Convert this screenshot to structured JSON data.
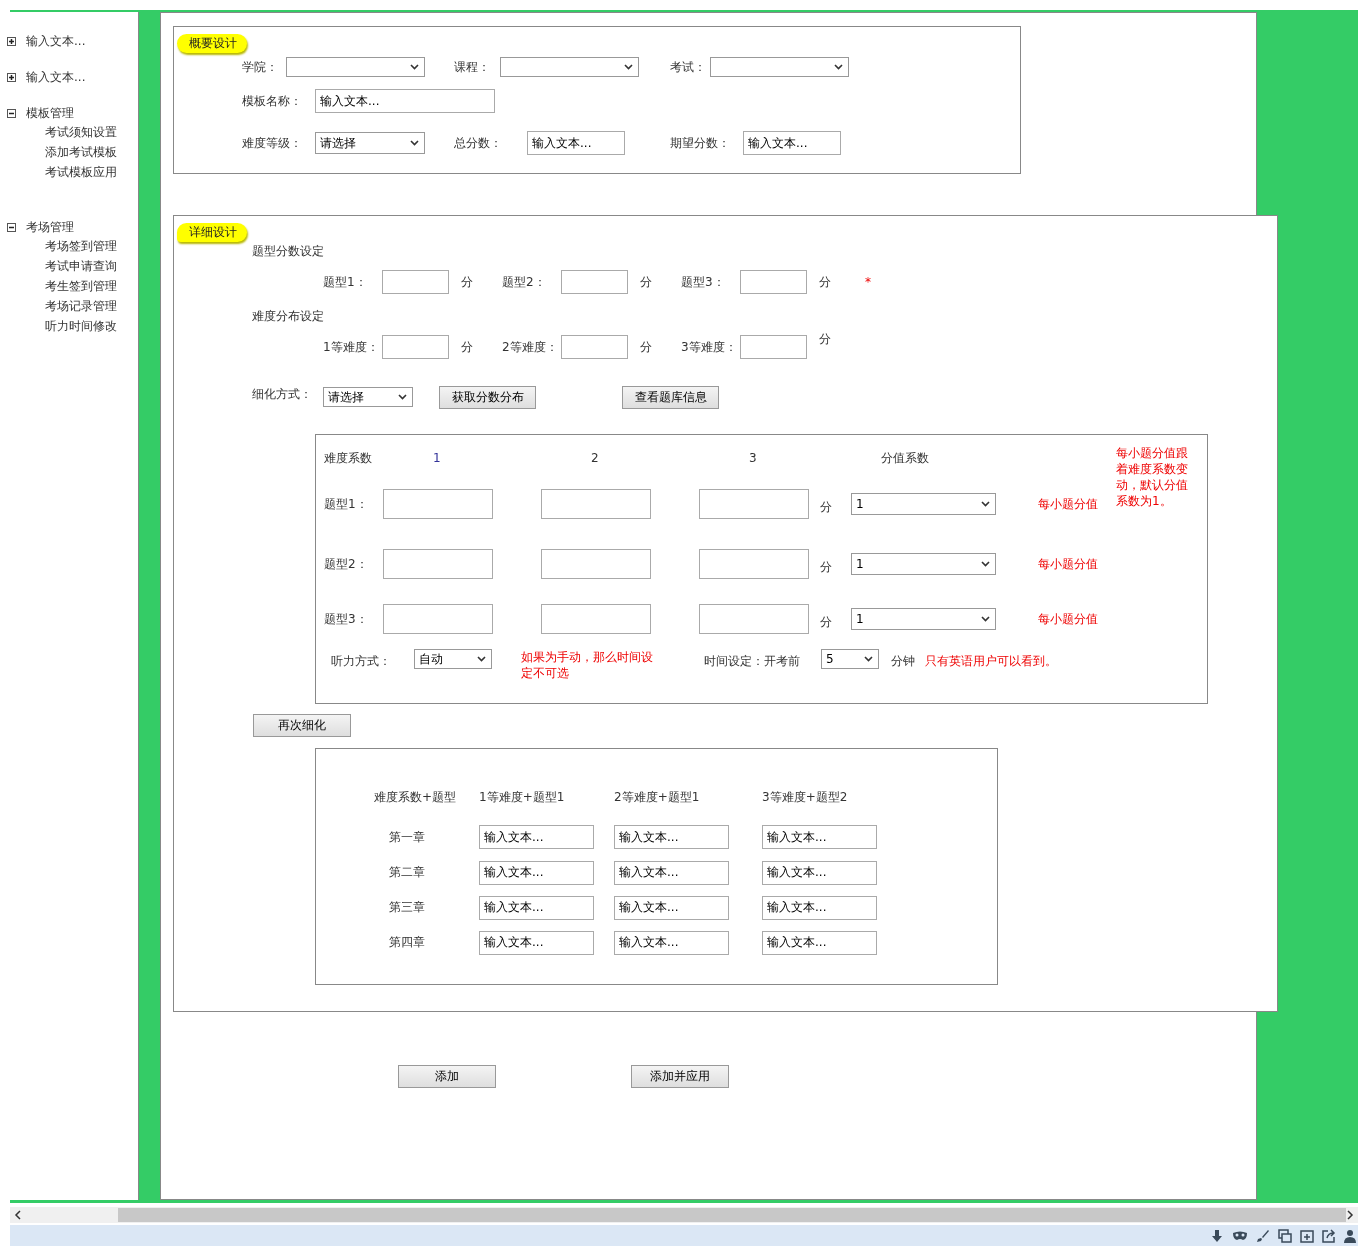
{
  "sidebar": {
    "items": [
      {
        "label": "输入文本...",
        "expanded": false
      },
      {
        "label": "输入文本...",
        "expanded": false
      },
      {
        "label": "模板管理",
        "expanded": true,
        "children": [
          {
            "label": "考试须知设置"
          },
          {
            "label": "添加考试模板"
          },
          {
            "label": "考试模板应用"
          }
        ]
      },
      {
        "label": "考场管理",
        "expanded": true,
        "children": [
          {
            "label": "考场签到管理"
          },
          {
            "label": "考试申请查询"
          },
          {
            "label": "考生签到管理"
          },
          {
            "label": "考场记录管理"
          },
          {
            "label": "听力时间修改"
          }
        ]
      }
    ]
  },
  "summary": {
    "title": "概要设计",
    "rows": [
      [
        {
          "label": "学院：",
          "kind": "select"
        },
        {
          "label": "课程：",
          "kind": "select"
        },
        {
          "label": "考试：",
          "kind": "select"
        }
      ],
      [
        {
          "label": "模板名称：",
          "kind": "input",
          "value": "输入文本..."
        }
      ],
      [
        {
          "label": "难度等级：",
          "kind": "select",
          "value": "请选择"
        },
        {
          "label": "总分数：",
          "kind": "input",
          "value": "输入文本..."
        },
        {
          "label": "期望分数：",
          "kind": "input",
          "value": "输入文本..."
        }
      ]
    ]
  },
  "detail": {
    "title": "详细设计",
    "score_settings": {
      "title": "题型分数设定",
      "fields": [
        {
          "label": "题型1：",
          "unit": "分"
        },
        {
          "label": "题型2：",
          "unit": "分"
        },
        {
          "label": "题型3：",
          "unit": "分"
        }
      ],
      "required_mark": "*"
    },
    "difficulty_settings": {
      "title": "难度分布设定",
      "fields": [
        {
          "label": "1等难度：",
          "unit": "分"
        },
        {
          "label": "2等难度：",
          "unit": "分"
        },
        {
          "label": "3等难度：",
          "unit": "分"
        }
      ]
    },
    "refine": {
      "label": "细化方式：",
      "select": "请选择",
      "buttons": [
        "获取分数分布",
        "查看题库信息"
      ]
    },
    "matrix": {
      "headers": [
        "难度系数",
        "1",
        "2",
        "3",
        "分值系数"
      ],
      "note": "每小题分值跟着难度系数变动，默认分值系数为1。",
      "rows": [
        {
          "label": "题型1：",
          "unit": "分",
          "coefficient": "1",
          "hint": "每小题分值"
        },
        {
          "label": "题型2：",
          "unit": "分",
          "coefficient": "1",
          "hint": "每小题分值"
        },
        {
          "label": "题型3：",
          "unit": "分",
          "coefficient": "1",
          "hint": "每小题分值"
        }
      ],
      "listening": {
        "label": "听力方式：",
        "select": "自动",
        "note": "如果为手动，那么时间设定不可选",
        "time_label": "时间设定：开考前",
        "time_select": "5",
        "time_unit": "分钟",
        "time_note": "只有英语用户可以看到。"
      }
    },
    "refine_again_button": "再次细化",
    "chapter_table": {
      "columns": [
        "难度系数+题型",
        "1等难度+题型1",
        "2等难度+题型1",
        "3等难度+题型2"
      ],
      "rows": [
        [
          "第一章",
          "输入文本...",
          "输入文本...",
          "输入文本..."
        ],
        [
          "第二章",
          "输入文本...",
          "输入文本...",
          "输入文本..."
        ],
        [
          "第三章",
          "输入文本...",
          "输入文本...",
          "输入文本..."
        ],
        [
          "第四章",
          "输入文本...",
          "输入文本...",
          "输入文本..."
        ]
      ]
    }
  },
  "actions": [
    "添加",
    "添加并应用"
  ]
}
